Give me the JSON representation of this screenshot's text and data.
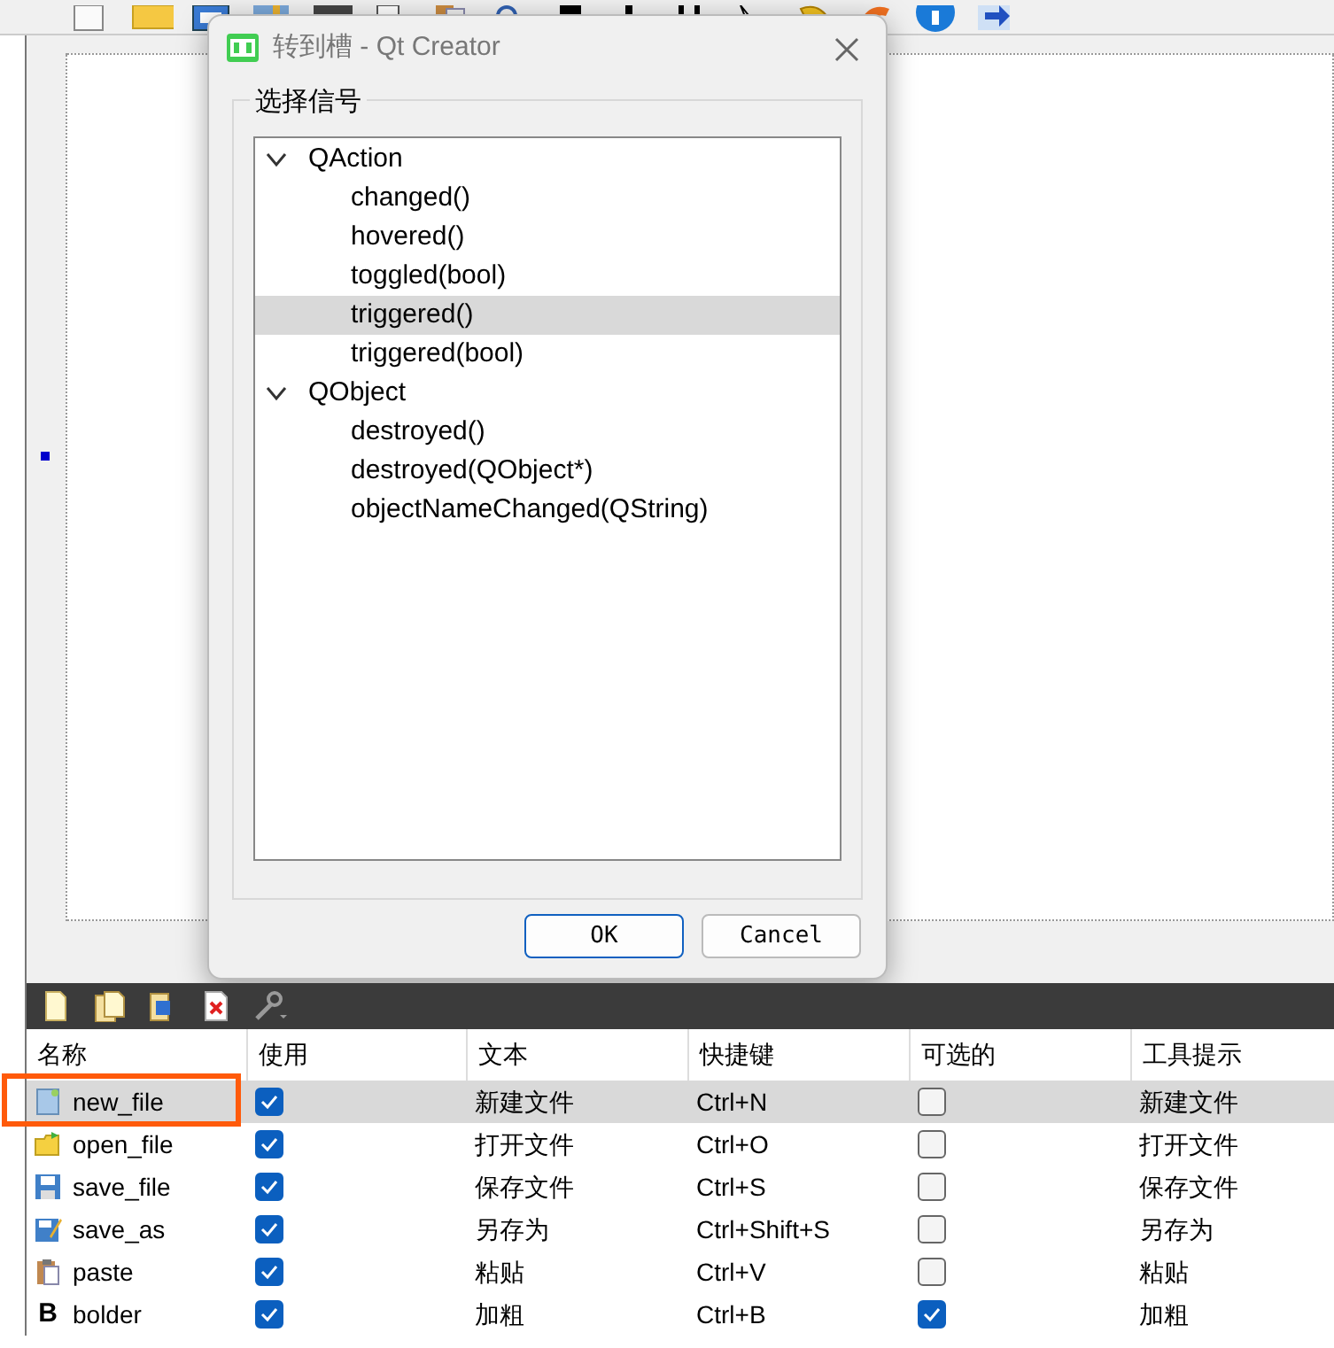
{
  "dialog": {
    "title": "转到槽 - Qt Creator",
    "group_label": "选择信号",
    "tree": [
      {
        "label": "QAction",
        "expanded": true,
        "selected": false,
        "children": [
          {
            "label": "changed()",
            "selected": false
          },
          {
            "label": "hovered()",
            "selected": false
          },
          {
            "label": "toggled(bool)",
            "selected": false
          },
          {
            "label": "triggered()",
            "selected": true
          },
          {
            "label": "triggered(bool)",
            "selected": false
          }
        ]
      },
      {
        "label": "QObject",
        "expanded": true,
        "selected": false,
        "children": [
          {
            "label": "destroyed()",
            "selected": false
          },
          {
            "label": "destroyed(QObject*)",
            "selected": false
          },
          {
            "label": "objectNameChanged(QString)",
            "selected": false
          }
        ]
      }
    ],
    "buttons": [
      "OK",
      "Cancel"
    ]
  },
  "action_editor": {
    "columns": [
      "名称",
      "使用",
      "文本",
      "快捷键",
      "可选的",
      "工具提示"
    ],
    "rows": [
      {
        "kind": "new",
        "name": "new_file",
        "used": true,
        "text": "新建文件",
        "shortcut": "Ctrl+N",
        "checkable": false,
        "tooltip": "新建文件",
        "selected": true,
        "highlighted": true
      },
      {
        "kind": "open",
        "name": "open_file",
        "used": true,
        "text": "打开文件",
        "shortcut": "Ctrl+O",
        "checkable": false,
        "tooltip": "打开文件",
        "selected": false,
        "highlighted": false
      },
      {
        "kind": "save",
        "name": "save_file",
        "used": true,
        "text": "保存文件",
        "shortcut": "Ctrl+S",
        "checkable": false,
        "tooltip": "保存文件",
        "selected": false,
        "highlighted": false
      },
      {
        "kind": "saveas",
        "name": "save_as",
        "used": true,
        "text": "另存为",
        "shortcut": "Ctrl+Shift+S",
        "checkable": false,
        "tooltip": "另存为",
        "selected": false,
        "highlighted": false
      },
      {
        "kind": "paste",
        "name": "paste",
        "used": true,
        "text": "粘贴",
        "shortcut": "Ctrl+V",
        "checkable": false,
        "tooltip": "粘贴",
        "selected": false,
        "highlighted": false
      },
      {
        "kind": "glyph",
        "icon_glyph": "B",
        "name": "bolder",
        "used": true,
        "text": "加粗",
        "shortcut": "Ctrl+B",
        "checkable": true,
        "tooltip": "加粗",
        "selected": false,
        "highlighted": false
      }
    ]
  }
}
